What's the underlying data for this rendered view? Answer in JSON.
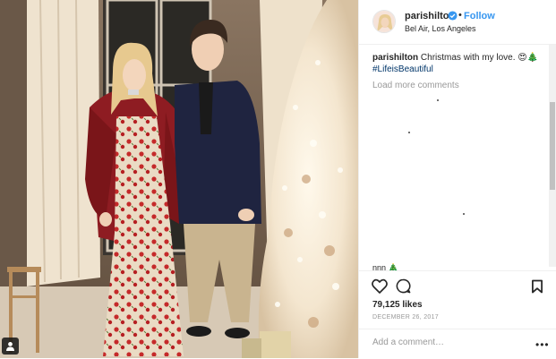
{
  "post": {
    "photo_alt": "Couple posing beside a white Christmas tree",
    "user_tag_icon": "user-icon"
  },
  "header": {
    "username": "parishilton",
    "verified_icon": "verified-badge-icon",
    "separator": "•",
    "follow_label": "Follow",
    "location": "Bel Air, Los Angeles"
  },
  "caption": {
    "username": "parishilton",
    "text": "Christmas with my love. 😍🎄",
    "hashtag": "#LifeisBeautiful"
  },
  "comments": {
    "load_more_label": "Load more comments",
    "cutoff_text": "nnn 🎄"
  },
  "actions": {
    "like_icon": "heart-icon",
    "comment_icon": "comment-icon",
    "save_icon": "bookmark-icon",
    "likes": "79,125 likes",
    "date": "DECEMBER 26, 2017",
    "add_comment_placeholder": "Add a comment…",
    "more_label": "•••"
  },
  "colors": {
    "accent": "#3897f0",
    "hashtag": "#003569",
    "muted": "#999999",
    "text": "#262626",
    "border": "#efefef"
  }
}
